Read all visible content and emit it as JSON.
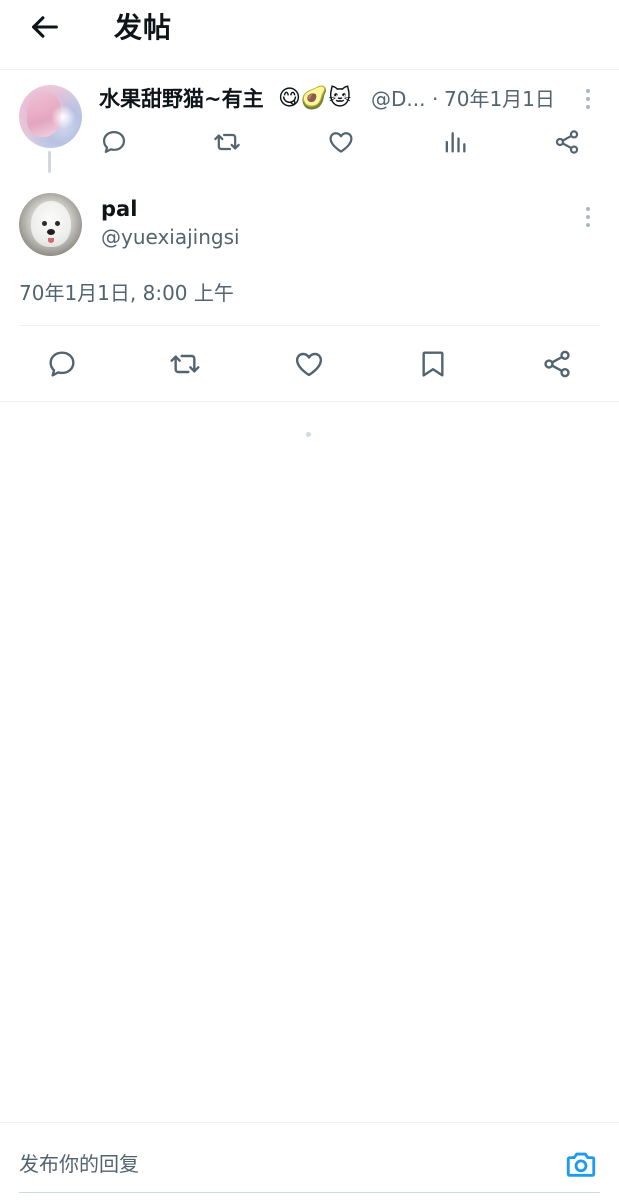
{
  "header": {
    "title": "发帖",
    "back_icon": "arrow-left-icon"
  },
  "parent_post": {
    "display_name": "水果甜野猫~有主",
    "name_emojis": "😋🥑🐱",
    "handle": "@D...",
    "separator": "·",
    "date": "70年1月1日",
    "actions": [
      "reply-icon",
      "repost-icon",
      "like-icon",
      "views-icon",
      "share-icon"
    ]
  },
  "main_post": {
    "display_name": "pal",
    "handle": "@yuexiajingsi",
    "timestamp": "70年1月1日, 8:00 上午",
    "actions": [
      "reply-icon",
      "repost-icon",
      "like-icon",
      "bookmark-icon",
      "share-icon"
    ]
  },
  "reply_bar": {
    "placeholder": "发布你的回复",
    "camera_icon": "camera-icon"
  },
  "colors": {
    "text_primary": "#0f1419",
    "text_secondary": "#536471",
    "divider": "#eff3f4",
    "accent": "#1d9bf0"
  }
}
